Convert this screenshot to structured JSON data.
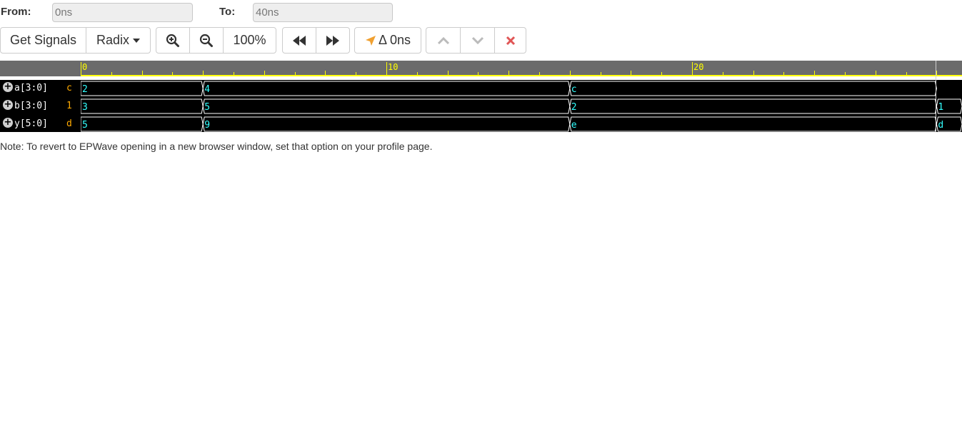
{
  "range": {
    "from_label": "From:",
    "from_value": "0ns",
    "to_label": "To:",
    "to_value": "40ns"
  },
  "toolbar": {
    "get_signals_label": "Get Signals",
    "radix_label": "Radix",
    "zoom_in_icon": "zoom-in-icon",
    "zoom_out_icon": "zoom-out-icon",
    "zoom_level": "100%",
    "prev_icon": "fast-backward-icon",
    "next_icon": "fast-forward-icon",
    "delta_label": "Δ 0ns",
    "move_up_icon": "chevron-up-icon",
    "move_down_icon": "chevron-down-icon",
    "remove_icon": "close-icon"
  },
  "colors": {
    "ruler_accent": "#ffff00",
    "signal_value": "#ffaa00",
    "wave_label": "#33ffff",
    "remove": "#e05555",
    "delta_arrow": "#f0a030"
  },
  "ruler": {
    "labels": [
      "0",
      "10",
      "20"
    ],
    "major_ticks_ns": [
      0,
      10,
      20
    ],
    "time_per_px_label": ""
  },
  "signals": [
    {
      "name": "a[3:0]",
      "cursor_value": "c",
      "segments": [
        {
          "start": 0,
          "end": 4,
          "label": "2"
        },
        {
          "start": 4,
          "end": 16,
          "label": "4"
        },
        {
          "start": 16,
          "end": 28,
          "label": "c"
        }
      ]
    },
    {
      "name": "b[3:0]",
      "cursor_value": "1",
      "segments": [
        {
          "start": 0,
          "end": 4,
          "label": "3"
        },
        {
          "start": 4,
          "end": 16,
          "label": "5"
        },
        {
          "start": 16,
          "end": 28,
          "label": "2"
        },
        {
          "start": 28,
          "end": 29,
          "label": "1"
        }
      ]
    },
    {
      "name": "y[5:0]",
      "cursor_value": "d",
      "segments": [
        {
          "start": 0,
          "end": 4,
          "label": "5"
        },
        {
          "start": 4,
          "end": 16,
          "label": "9"
        },
        {
          "start": 16,
          "end": 28,
          "label": "e"
        },
        {
          "start": 28,
          "end": 29,
          "label": "d"
        }
      ]
    }
  ],
  "note": "Note: To revert to EPWave opening in a new browser window, set that option on your profile page."
}
